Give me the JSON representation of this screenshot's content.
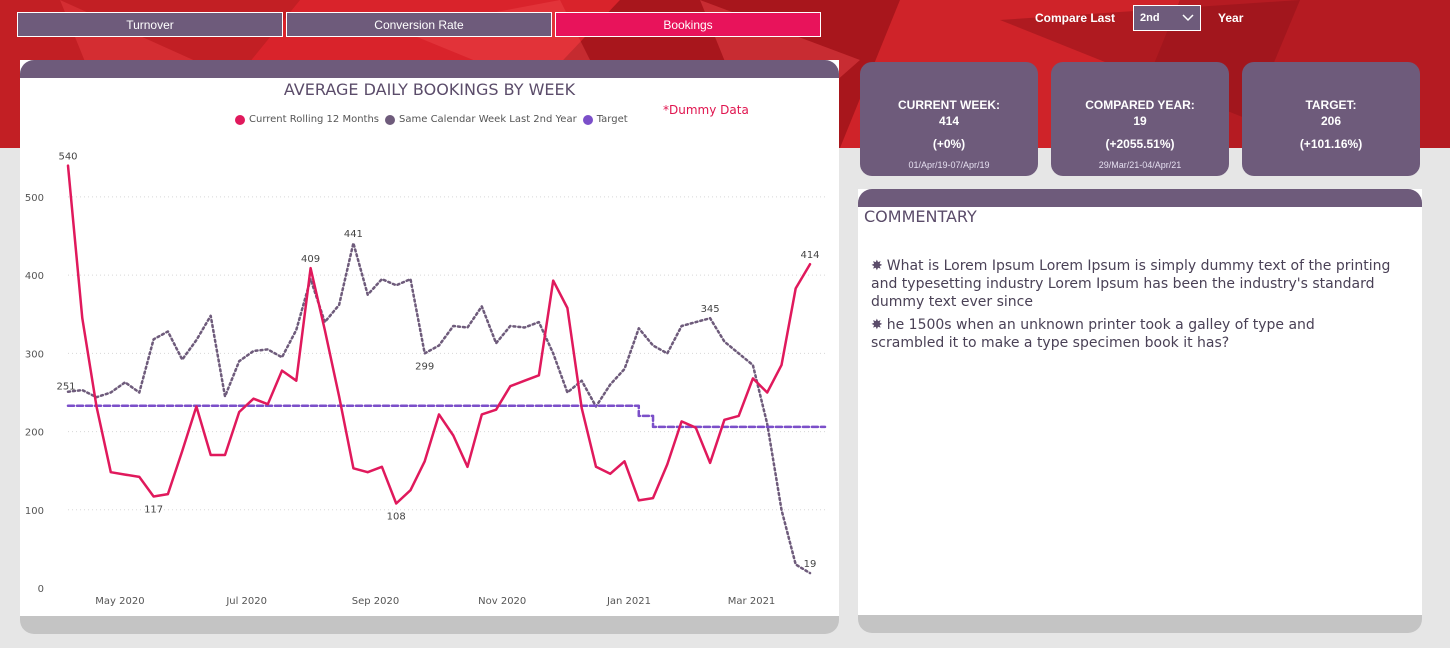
{
  "tabs": [
    {
      "label": "Turnover",
      "active": false
    },
    {
      "label": "Conversion Rate",
      "active": false
    },
    {
      "label": "Bookings",
      "active": true
    }
  ],
  "compare": {
    "prefix": "Compare Last",
    "value": "2nd",
    "suffix": "Year"
  },
  "chart": {
    "title": "AVERAGE DAILY BOOKINGS BY WEEK",
    "note": "*Dummy Data",
    "legend": [
      {
        "label": "Current Rolling 12 Months",
        "color": "#e0195c"
      },
      {
        "label": "Same Calendar Week Last 2nd Year",
        "color": "#6e5b7b"
      },
      {
        "label": "Target",
        "color": "#7b4fc9"
      }
    ]
  },
  "chart_data": {
    "type": "line",
    "x": [
      "2020-04-06",
      "2020-04-13",
      "2020-04-20",
      "2020-04-27",
      "2020-05-04",
      "2020-05-11",
      "2020-05-18",
      "2020-05-25",
      "2020-06-01",
      "2020-06-08",
      "2020-06-15",
      "2020-06-22",
      "2020-06-29",
      "2020-07-06",
      "2020-07-13",
      "2020-07-20",
      "2020-07-27",
      "2020-08-03",
      "2020-08-10",
      "2020-08-17",
      "2020-08-24",
      "2020-08-31",
      "2020-09-07",
      "2020-09-14",
      "2020-09-21",
      "2020-09-28",
      "2020-10-05",
      "2020-10-12",
      "2020-10-19",
      "2020-10-26",
      "2020-11-02",
      "2020-11-09",
      "2020-11-16",
      "2020-11-23",
      "2020-11-30",
      "2020-12-07",
      "2020-12-14",
      "2020-12-21",
      "2020-12-28",
      "2021-01-04",
      "2021-01-11",
      "2021-01-18",
      "2021-01-25",
      "2021-02-01",
      "2021-02-08",
      "2021-02-15",
      "2021-02-22",
      "2021-03-01",
      "2021-03-08",
      "2021-03-15",
      "2021-03-22",
      "2021-03-29"
    ],
    "series": [
      {
        "name": "Current Rolling 12 Months",
        "values": [
          540,
          345,
          232,
          148,
          145,
          142,
          117,
          120,
          175,
          232,
          170,
          170,
          225,
          242,
          235,
          278,
          265,
          409,
          330,
          245,
          153,
          148,
          155,
          108,
          125,
          162,
          222,
          195,
          155,
          222,
          228,
          258,
          265,
          272,
          393,
          358,
          230,
          155,
          146,
          162,
          112,
          115,
          158,
          213,
          205,
          160,
          215,
          220,
          268,
          250,
          285,
          383,
          414
        ]
      },
      {
        "name": "Same Calendar Week Last 2nd Year",
        "values": [
          251,
          253,
          244,
          250,
          263,
          250,
          318,
          328,
          292,
          317,
          348,
          245,
          290,
          303,
          305,
          295,
          330,
          395,
          340,
          362,
          441,
          375,
          395,
          387,
          395,
          300,
          310,
          335,
          333,
          360,
          313,
          335,
          333,
          340,
          300,
          250,
          265,
          232,
          260,
          280,
          332,
          310,
          300,
          335,
          340,
          345,
          315,
          300,
          285,
          210,
          100,
          30,
          19
        ]
      },
      {
        "name": "Target",
        "values": [
          233,
          233,
          233,
          233,
          233,
          233,
          233,
          233,
          233,
          233,
          233,
          233,
          233,
          233,
          233,
          233,
          233,
          233,
          233,
          233,
          233,
          233,
          233,
          233,
          233,
          233,
          233,
          233,
          233,
          233,
          233,
          233,
          233,
          233,
          233,
          233,
          233,
          233,
          233,
          233,
          220,
          206,
          206,
          206,
          206,
          206,
          206,
          206,
          206,
          206,
          206,
          206,
          206
        ]
      }
    ],
    "x_ticks": [
      "May 2020",
      "Jul 2020",
      "Sep 2020",
      "Nov 2020",
      "Jan 2021",
      "Mar 2021"
    ],
    "y_ticks": [
      0,
      100,
      200,
      300,
      400,
      500
    ],
    "ylim": [
      0,
      560
    ],
    "data_labels": [
      {
        "series": 0,
        "index": 0,
        "text": "540"
      },
      {
        "series": 0,
        "index": 17,
        "text": "409"
      },
      {
        "series": 0,
        "index": 6,
        "text": "117"
      },
      {
        "series": 0,
        "index": 23,
        "text": "108"
      },
      {
        "series": 0,
        "index": 52,
        "text": "414"
      },
      {
        "series": 1,
        "index": 0,
        "text": "251"
      },
      {
        "series": 1,
        "index": 20,
        "text": "441"
      },
      {
        "series": 1,
        "index": 25,
        "text": "299"
      },
      {
        "series": 1,
        "index": 45,
        "text": "345"
      },
      {
        "series": 1,
        "index": 52,
        "text": "19"
      }
    ],
    "grid": true
  },
  "kpis": [
    {
      "label": "CURRENT WEEK:",
      "value": "414",
      "change": "(+0%)",
      "range": "01/Apr/19-07/Apr/19"
    },
    {
      "label": "COMPARED YEAR:",
      "value": "19",
      "change": "(+2055.51%)",
      "range": "29/Mar/21-04/Apr/21"
    },
    {
      "label": "TARGET:",
      "value": "206",
      "change": "(+101.16%)",
      "range": ""
    }
  ],
  "commentary": {
    "title": "COMMENTARY",
    "bullets": [
      "What is Lorem Ipsum Lorem Ipsum is simply dummy text of the printing and typesetting industry Lorem Ipsum has been the industry's standard dummy text ever since",
      "he 1500s when an unknown printer took a galley of type and scrambled it to make a type specimen book it has?"
    ]
  },
  "colors": {
    "accent": "#e8135b",
    "panel": "#6e5b7b",
    "target": "#7b4fc9"
  }
}
